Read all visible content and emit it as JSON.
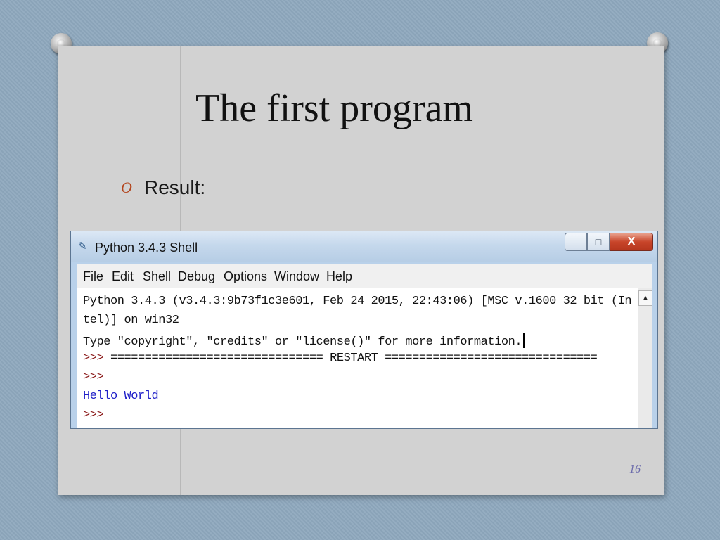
{
  "slide": {
    "title": "The first program",
    "bullet_marker": "O",
    "bullet_text": "Result:",
    "page_number": "16"
  },
  "window": {
    "title": "Python 3.4.3 Shell",
    "icons": {
      "app": "python-shell-icon",
      "minimize": "minimize-icon",
      "maximize": "maximize-icon",
      "close": "close-icon",
      "scroll_up": "scroll-up-arrow-icon"
    },
    "menu": [
      {
        "label": "File"
      },
      {
        "label": "Edit"
      },
      {
        "label": "Shell"
      },
      {
        "label": "Debug"
      },
      {
        "label": "Options"
      },
      {
        "label": "Window"
      },
      {
        "label": "Help"
      }
    ]
  },
  "shell": {
    "line1": "Python 3.4.3 (v3.4.3:9b73f1c3e601, Feb 24 2015, 22:43:06) [MSC v.1600 32 bit (In",
    "line2": "tel)] on win32",
    "line3": "Type \"copyright\", \"credits\" or \"license()\" for more information.",
    "prompt": ">>>",
    "restart": " =============================== RESTART ===============================",
    "output": "Hello World"
  },
  "colors": {
    "prompt": "#8b1a1a",
    "output": "#2020c8",
    "bullet": "#b3441c"
  }
}
